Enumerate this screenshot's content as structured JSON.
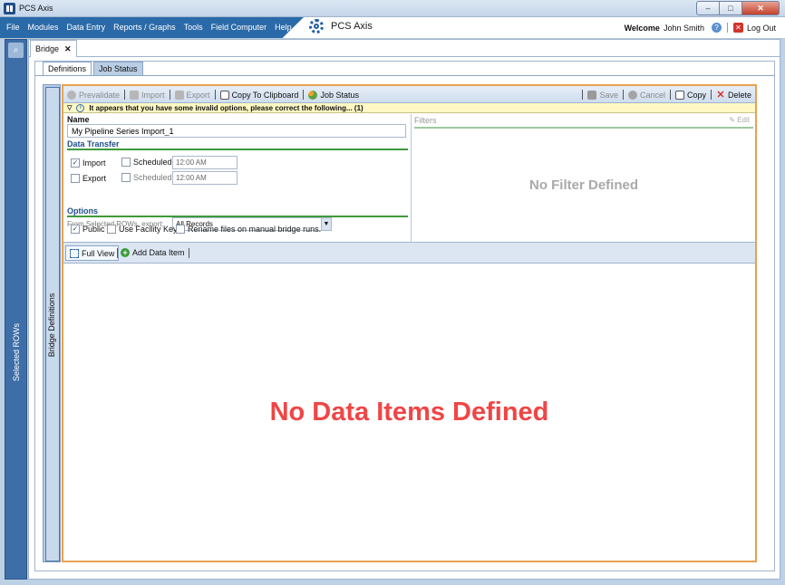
{
  "window": {
    "title": "PCS Axis",
    "controls": {
      "minimize": "–",
      "maximize": "□",
      "close": "✕"
    }
  },
  "menubar": {
    "items": [
      "File",
      "Modules",
      "Data Entry",
      "Reports / Graphs",
      "Tools",
      "Field Computer",
      "Help"
    ],
    "brand": "PCS Axis",
    "welcome_label": "Welcome",
    "user": "John Smith",
    "logout": "Log Out"
  },
  "left_dock": {
    "label": "Selected ROWs"
  },
  "document_tab": {
    "label": "Bridge",
    "close": "✕"
  },
  "subtabs": {
    "definitions": "Definitions",
    "job_status": "Job Status"
  },
  "side_strip": {
    "label": "Bridge Definitions"
  },
  "toolbar": {
    "prevalidate": "Prevalidate",
    "import": "Import",
    "export": "Export",
    "copy_clipboard": "Copy To Clipboard",
    "job_status": "Job Status",
    "save": "Save",
    "cancel": "Cancel",
    "copy": "Copy",
    "delete": "Delete"
  },
  "warning": {
    "text": "It appears that you have some invalid options, please correct the following... (1)"
  },
  "form": {
    "name_label": "Name",
    "name_value": "My Pipeline Series Import_1",
    "data_transfer": "Data Transfer",
    "import_label": "Import",
    "import_checked": true,
    "export_label": "Export",
    "export_checked": false,
    "scheduled_label": "Scheduled",
    "import_time": "12:00 AM",
    "export_time": "12:00 AM",
    "rows_label": "From Selected ROWs, export:",
    "rows_value": "All Records",
    "options": "Options",
    "public_label": "Public",
    "public_checked": true,
    "facility_key_label": "Use Facility Key",
    "rename_label": "Rename files on manual bridge runs."
  },
  "filters": {
    "header": "Filters",
    "edit": "Edit",
    "empty": "No Filter Defined"
  },
  "items_toolbar": {
    "full_view": "Full View",
    "add_item": "Add Data Item"
  },
  "empty_state": "No Data Items Defined"
}
